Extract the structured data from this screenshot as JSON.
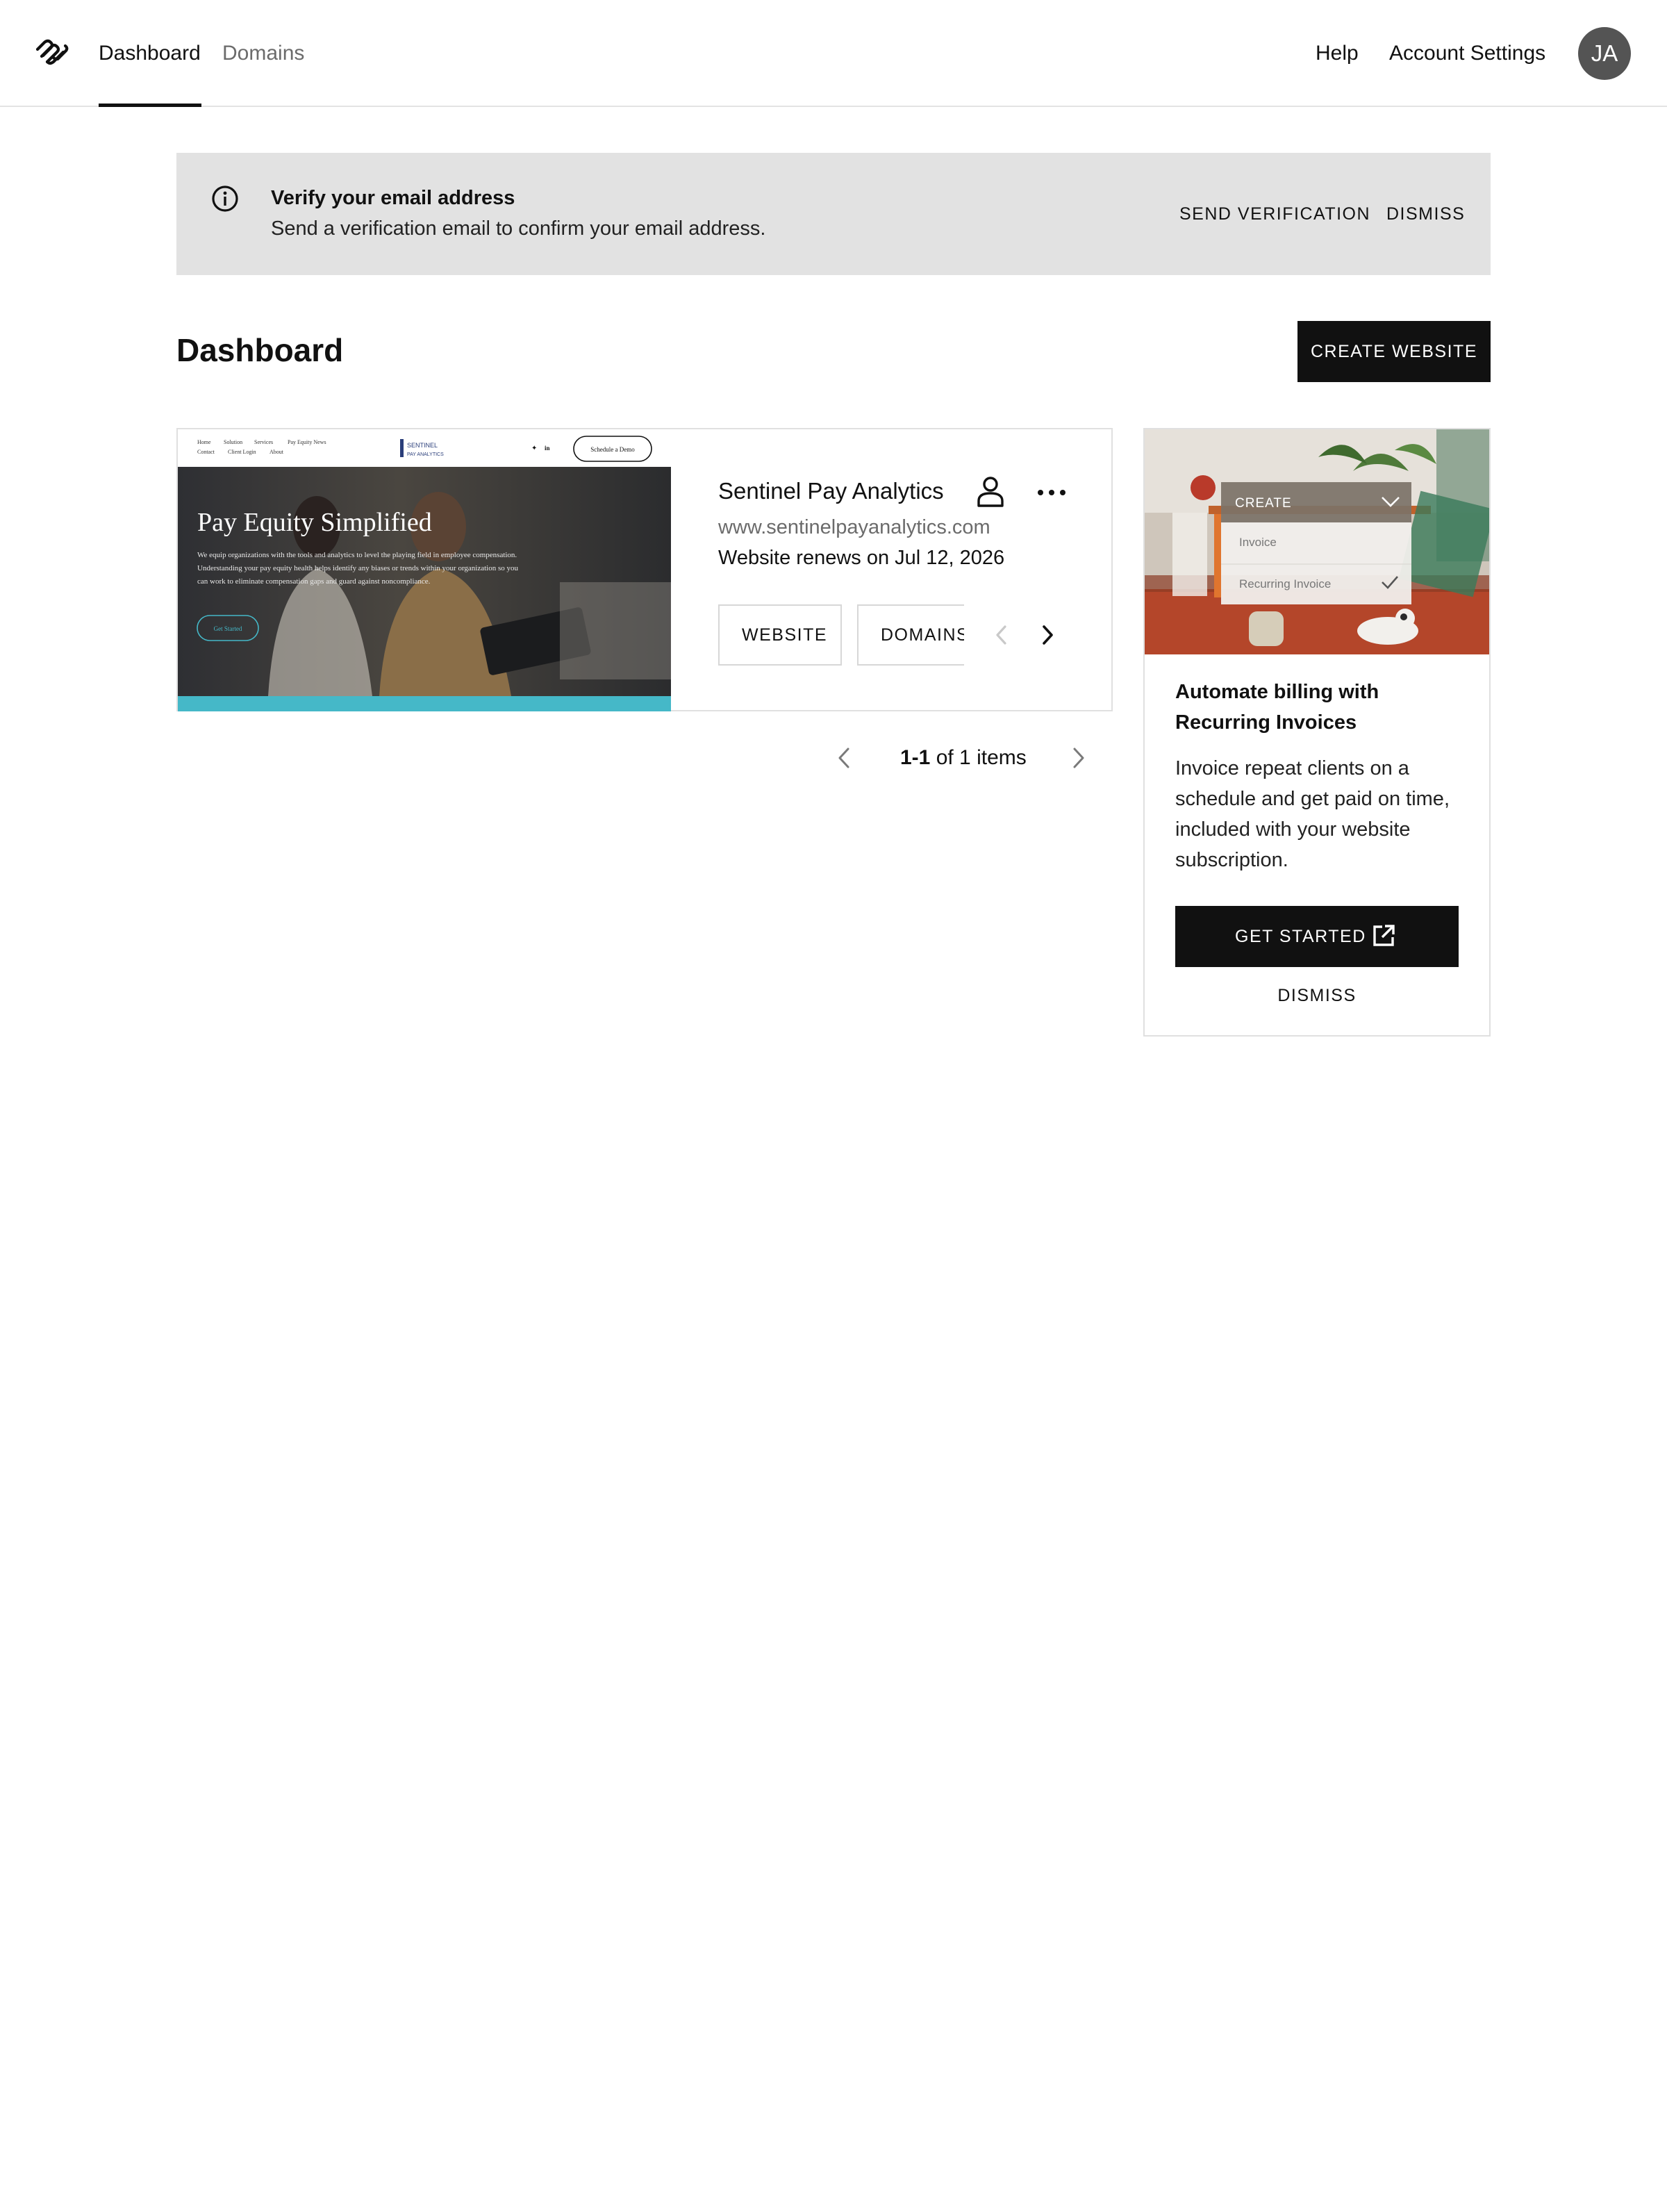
{
  "nav": {
    "tabs": [
      {
        "label": "Dashboard",
        "active": true
      },
      {
        "label": "Domains",
        "active": false
      }
    ],
    "help": "Help",
    "account_settings": "Account Settings",
    "avatar_initials": "JA"
  },
  "banner": {
    "title": "Verify your email address",
    "text": "Send a verification email to confirm your email address.",
    "send_label": "SEND VERIFICATION",
    "dismiss_label": "DISMISS",
    "icon": "info-icon"
  },
  "page": {
    "title": "Dashboard",
    "create_label": "CREATE WEBSITE"
  },
  "site": {
    "name": "Sentinel Pay Analytics",
    "url": "www.sentinelpayanalytics.com",
    "renewal": "Website renews on Jul 12, 2026",
    "chips": [
      "WEBSITE",
      "DOMAINS"
    ],
    "thumbnail": {
      "nav_links_row1": [
        "Home",
        "Solution",
        "Services",
        "Pay Equity News"
      ],
      "nav_links_row2": [
        "Contact",
        "Client Login",
        "About"
      ],
      "brand_line1": "SENTINEL",
      "brand_line2": "PAY ANALYTICS",
      "cta": "Schedule a Demo",
      "hero_title": "Pay Equity Simplified",
      "hero_text": "We equip organizations with the tools and analytics to level the playing field in employee compensation. Understanding your pay equity health helps identify any biases or trends within your organization so you can work to eliminate compensation gaps and guard against noncompliance.",
      "hero_button": "Get Started",
      "accent_color": "#45b8c8"
    }
  },
  "pagination": {
    "range": "1-1",
    "rest": "of 1 items"
  },
  "promo": {
    "image": {
      "menu_header": "CREATE",
      "menu_items": [
        "Invoice",
        "Recurring Invoice"
      ]
    },
    "title": "Automate billing with Recurring Invoices",
    "text": "Invoice repeat clients on a schedule and get paid on time, included with your website subscription.",
    "button_label": "GET STARTED",
    "dismiss_label": "DISMISS"
  }
}
